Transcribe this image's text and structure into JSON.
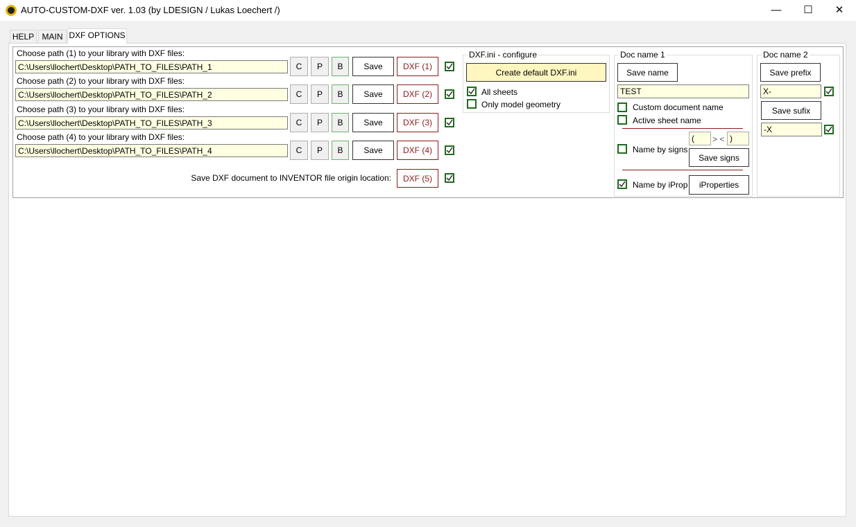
{
  "window": {
    "title": "AUTO-CUSTOM-DXF ver. 1.03 (by LDESIGN / Lukas Loechert /)",
    "minimize": "—",
    "maximize": "☐",
    "close": "✕"
  },
  "tabs": [
    {
      "label": "HELP"
    },
    {
      "label": "MAIN"
    },
    {
      "label": "DXF OPTIONS",
      "selected": true
    }
  ],
  "paths": [
    {
      "label": "Choose path (1) to your library with DXF files:",
      "value": "C:\\Users\\llochert\\Desktop\\PATH_TO_FILES\\PATH_1",
      "c": "C",
      "p": "P",
      "b": "B",
      "save": "Save",
      "dxf": "DXF (1)",
      "checked": true
    },
    {
      "label": "Choose path (2) to your library with DXF files:",
      "value": "C:\\Users\\llochert\\Desktop\\PATH_TO_FILES\\PATH_2",
      "c": "C",
      "p": "P",
      "b": "B",
      "save": "Save",
      "dxf": "DXF (2)",
      "checked": true
    },
    {
      "label": "Choose path (3) to your library with DXF files:",
      "value": "C:\\Users\\llochert\\Desktop\\PATH_TO_FILES\\PATH_3",
      "c": "C",
      "p": "P",
      "b": "B",
      "save": "Save",
      "dxf": "DXF (3)",
      "checked": true
    },
    {
      "label": "Choose path (4) to your library with DXF files:",
      "value": "C:\\Users\\llochert\\Desktop\\PATH_TO_FILES\\PATH_4",
      "c": "C",
      "p": "P",
      "b": "B",
      "save": "Save",
      "dxf": "DXF (4)",
      "checked": true
    }
  ],
  "origin": {
    "label": "Save DXF document to INVENTOR file origin location:",
    "dxf": "DXF (5)",
    "checked": true
  },
  "dxfini": {
    "legend": "DXF.ini - configure",
    "create": "Create default DXF.ini",
    "all_sheets": "All sheets",
    "all_sheets_checked": true,
    "only_model": "Only model geometry",
    "only_model_checked": false
  },
  "doc1": {
    "legend": "Doc name 1",
    "save_name": "Save name",
    "name_value": "TEST",
    "custom": "Custom document name",
    "custom_checked": false,
    "active": "Active sheet name",
    "active_checked": false,
    "sign_open": "(",
    "sign_sep": "> <",
    "sign_close": ")",
    "by_signs": "Name by signs",
    "by_signs_checked": false,
    "save_signs": "Save signs",
    "by_iprop": "Name by iProp",
    "by_iprop_checked": true,
    "iprops": "iProperties"
  },
  "doc2": {
    "legend": "Doc name 2",
    "save_prefix": "Save prefix",
    "prefix": "X-",
    "prefix_checked": true,
    "save_sufix": "Save sufix",
    "sufix": "-X",
    "sufix_checked": true
  }
}
